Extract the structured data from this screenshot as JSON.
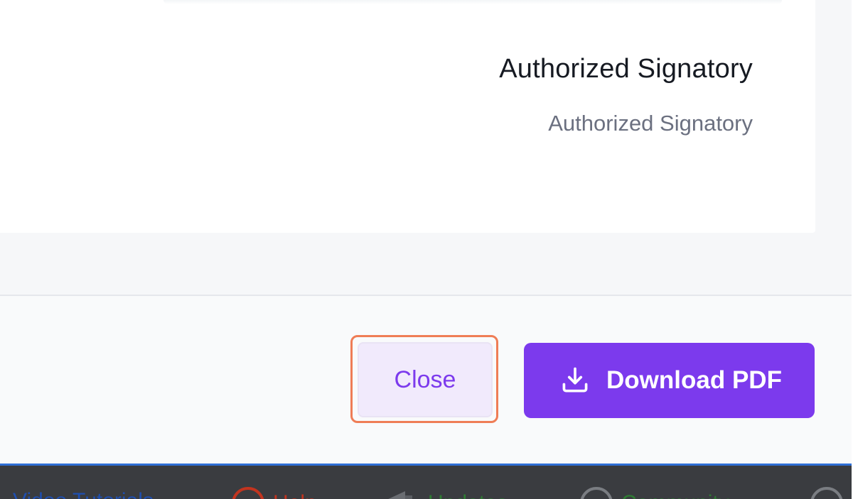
{
  "document": {
    "signatory_name": "Authorized Signatory",
    "signatory_title": "Authorized Signatory"
  },
  "footer": {
    "close_label": "Close",
    "download_label": "Download PDF",
    "download_icon": "download-icon"
  },
  "bottom_bar": {
    "items": [
      {
        "label": "Video Tutorials",
        "icon": "video-icon",
        "color": "#1f4fb0"
      },
      {
        "label": "Help",
        "icon": "help-circle-icon",
        "color": "#c2341f"
      },
      {
        "label": "Updates",
        "icon": "megaphone-icon",
        "color": "#2e7d32"
      },
      {
        "label": "Community",
        "icon": "chat-icon",
        "color": "#2e7d32"
      }
    ]
  },
  "colors": {
    "accent": "#7c3aed",
    "accent_soft": "#f1eafc",
    "highlight": "#ef7d56"
  }
}
